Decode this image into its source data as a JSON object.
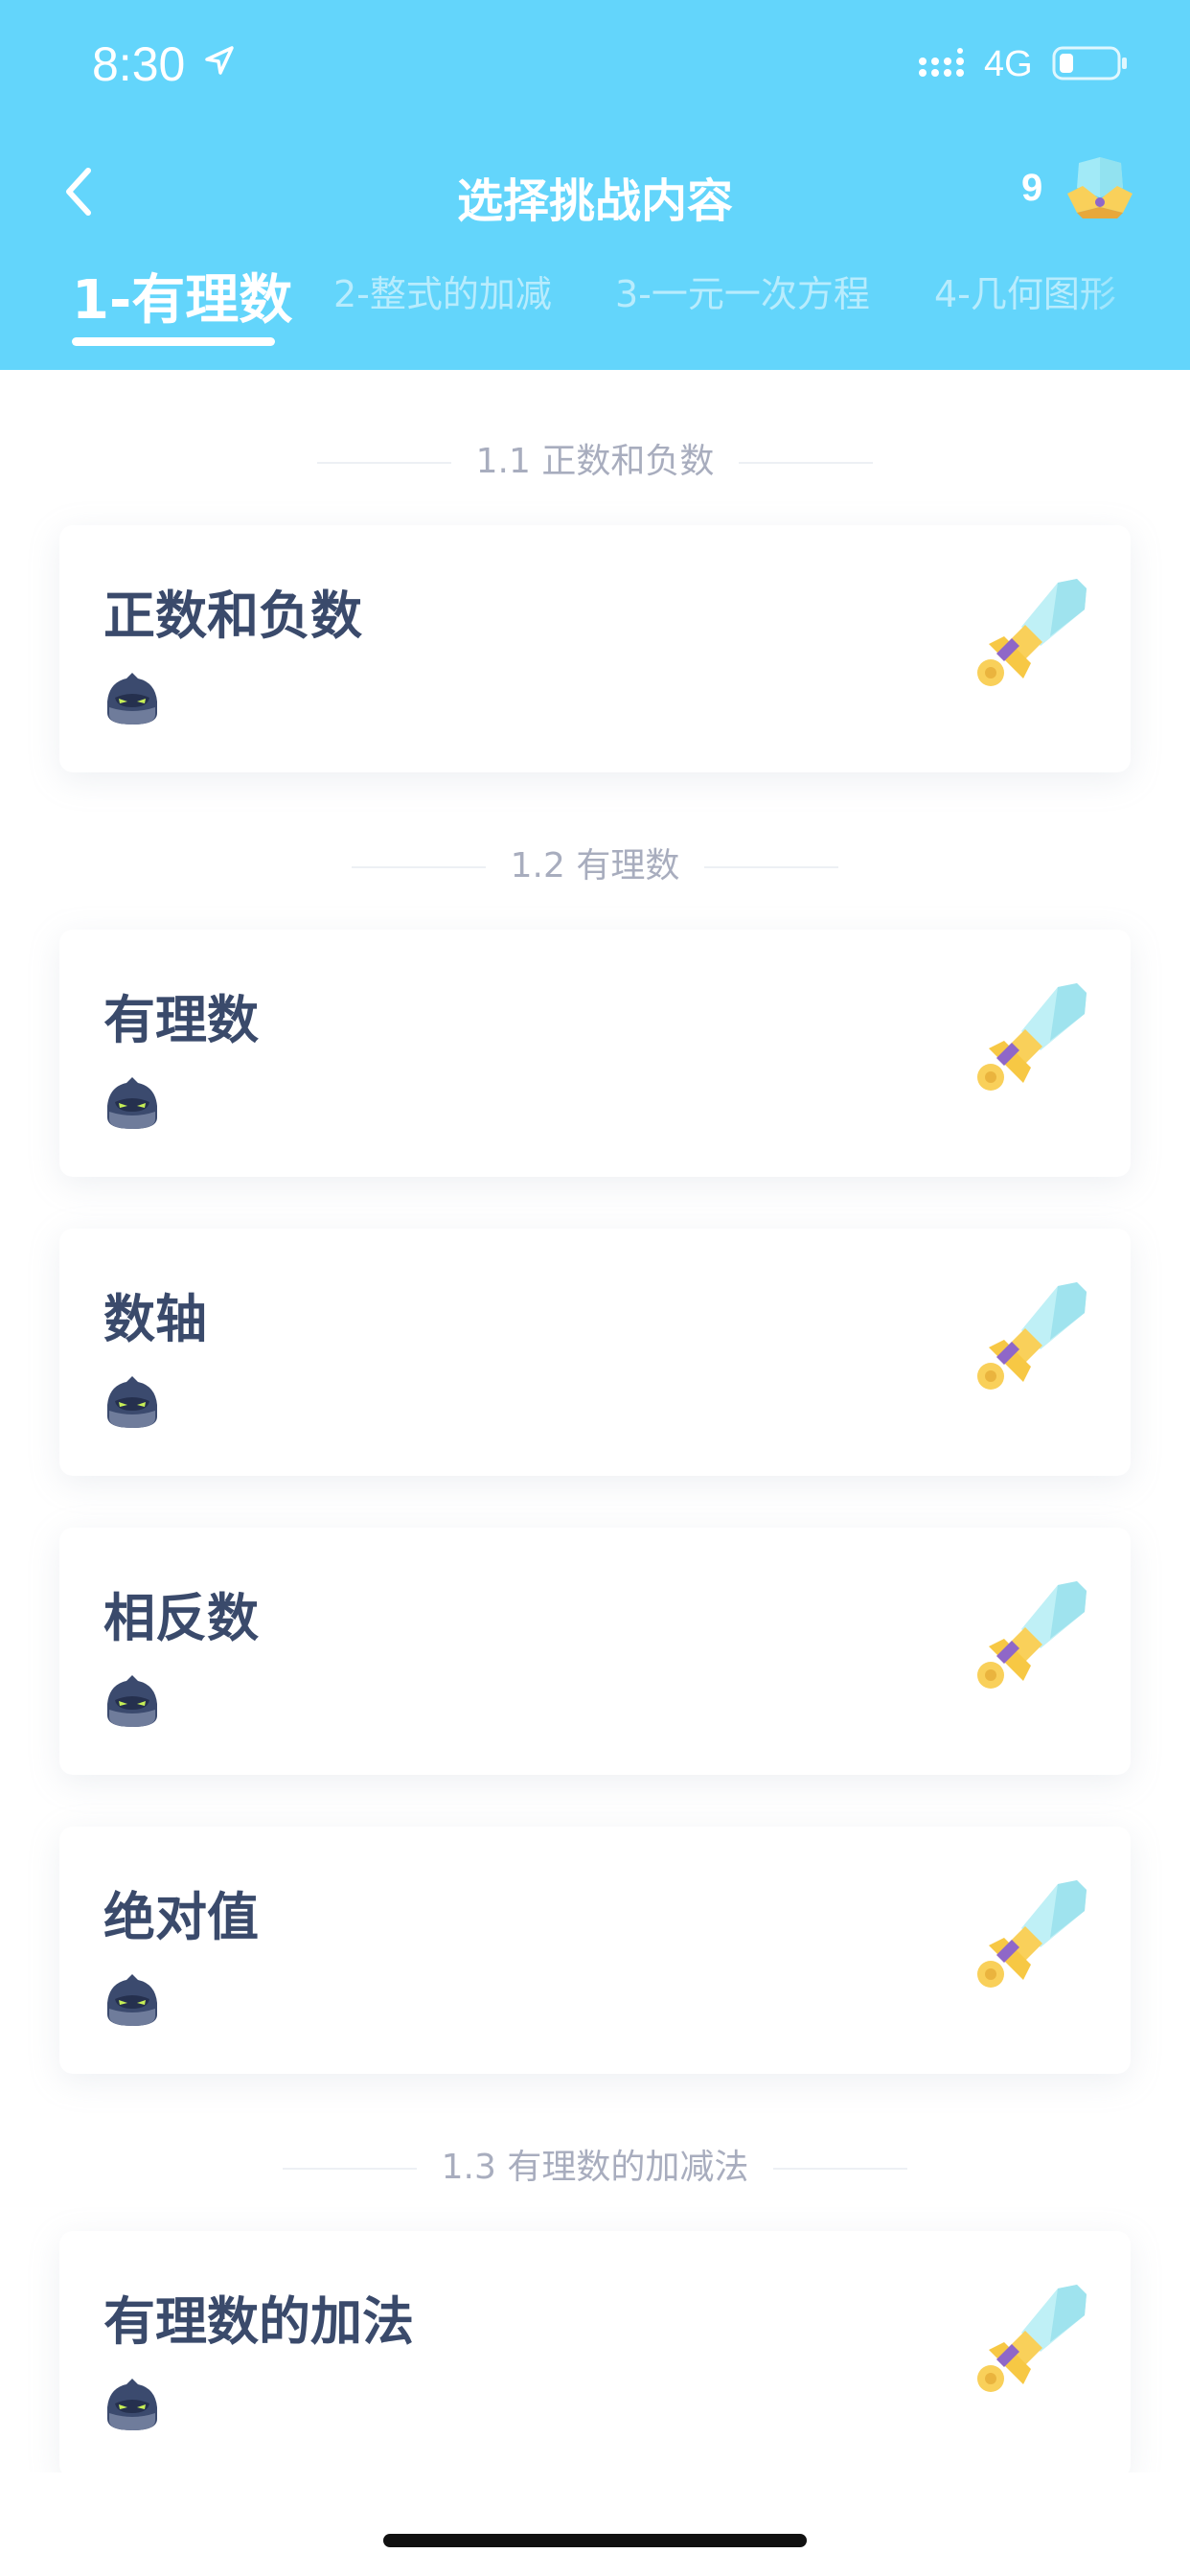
{
  "status_bar": {
    "time": "8:30",
    "network": "4G"
  },
  "nav": {
    "title": "选择挑战内容",
    "coin_count": "9"
  },
  "tabs": [
    {
      "label": "1-有理数"
    },
    {
      "label": "2-整式的加减"
    },
    {
      "label": "3-一元一次方程"
    },
    {
      "label": "4-几何图形"
    }
  ],
  "sections": [
    {
      "title": "1.1 正数和负数",
      "items": [
        {
          "title": "正数和负数"
        }
      ]
    },
    {
      "title": "1.2 有理数",
      "items": [
        {
          "title": "有理数"
        },
        {
          "title": "数轴"
        },
        {
          "title": "相反数"
        },
        {
          "title": "绝对值"
        }
      ]
    },
    {
      "title": "1.3 有理数的加减法",
      "items": [
        {
          "title": "有理数的加法"
        }
      ]
    }
  ],
  "colors": {
    "header": "#63d5fb",
    "title_text": "#3a4a6b",
    "section_text": "#a8adbe"
  },
  "icons": {
    "back": "chevron-left-icon",
    "reward": "helmet-icon",
    "enemy": "ninja-icon",
    "challenge": "sword-icon"
  }
}
